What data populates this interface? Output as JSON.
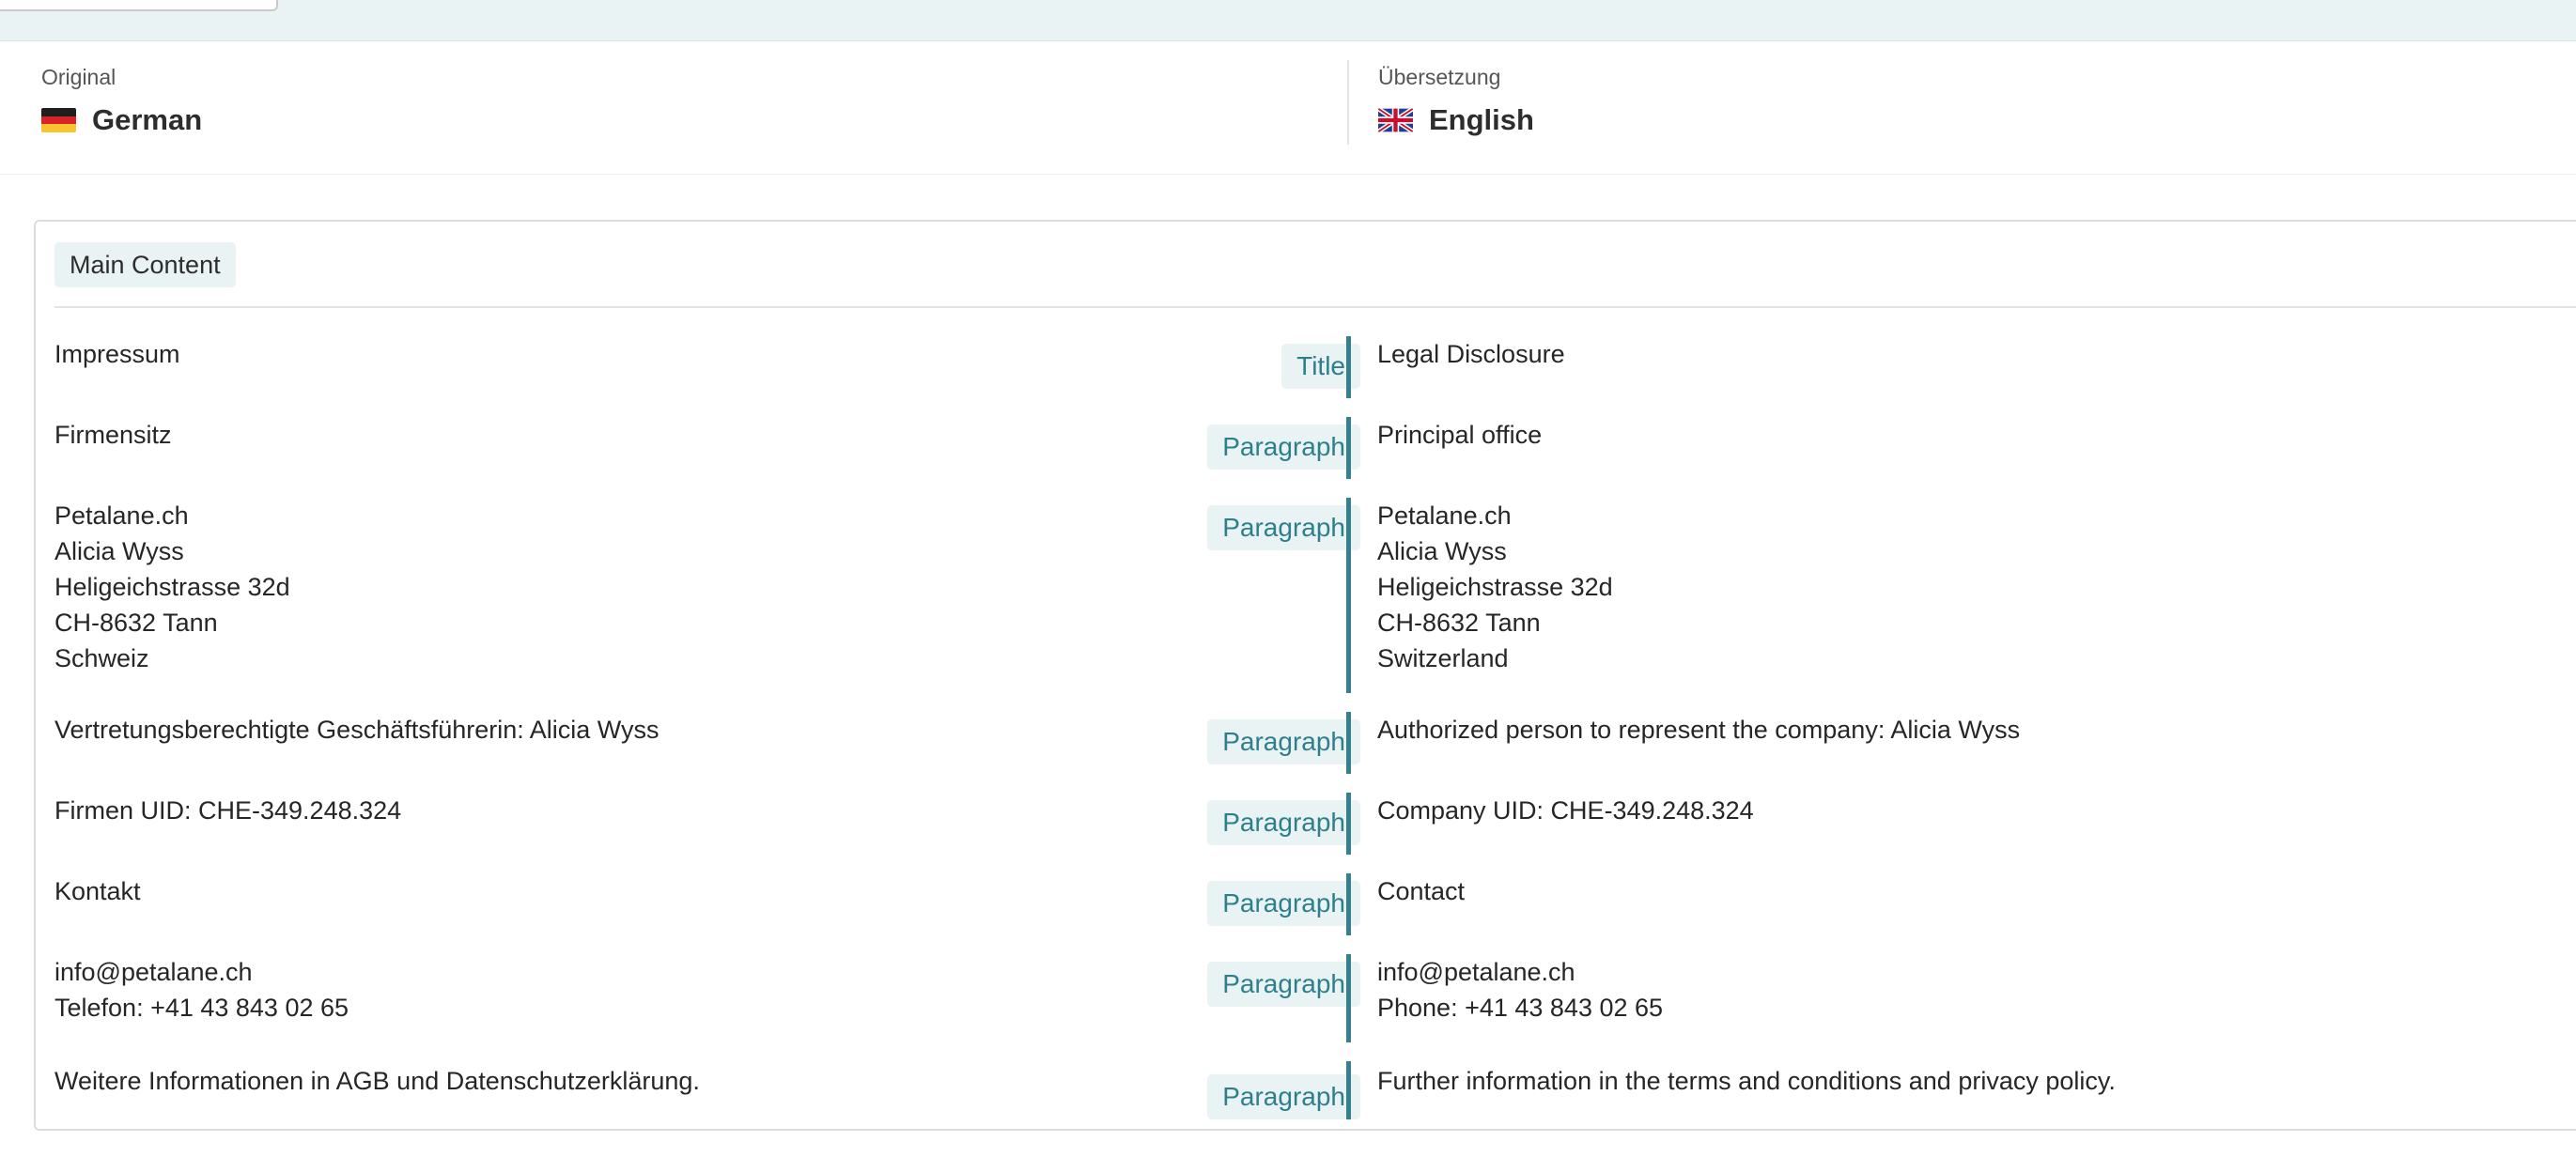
{
  "header": {
    "original_caption": "Original",
    "original_language": "German",
    "original_flag": "flag-germany-icon",
    "translation_caption": "Übersetzung",
    "translation_language": "English",
    "translation_flag": "flag-uk-icon"
  },
  "section": {
    "label": "Main Content"
  },
  "rows": [
    {
      "original": "Impressum",
      "type": "Title",
      "translation": "Legal Disclosure"
    },
    {
      "original": "Firmensitz",
      "type": "Paragraph",
      "translation": "Principal office"
    },
    {
      "original": "Petalane.ch\nAlicia Wyss\nHeligeichstrasse 32d\nCH-8632 Tann\nSchweiz",
      "type": "Paragraph",
      "translation": "Petalane.ch\nAlicia Wyss\nHeligeichstrasse 32d\nCH-8632 Tann\nSwitzerland"
    },
    {
      "original": "Vertretungsberechtigte Geschäftsführerin: Alicia Wyss",
      "type": "Paragraph",
      "translation": "Authorized person to represent the company: Alicia Wyss"
    },
    {
      "original": "Firmen UID: CHE-349.248.324",
      "type": "Paragraph",
      "translation": "Company UID: CHE-349.248.324"
    },
    {
      "original": "Kontakt",
      "type": "Paragraph",
      "translation": "Contact"
    },
    {
      "original": "info@petalane.ch\nTelefon: +41 43 843 02 65",
      "type": "Paragraph",
      "translation": "info@petalane.ch\nPhone: +41 43 843 02 65"
    },
    {
      "original": "Weitere Informationen in AGB und Datenschutzerklärung.",
      "type": "Paragraph",
      "translation": "Further information in the terms and conditions and privacy policy."
    }
  ],
  "colors": {
    "accent": "#34818d",
    "tag_background": "#e9f3f4",
    "tag_text": "#2d7f8c"
  }
}
